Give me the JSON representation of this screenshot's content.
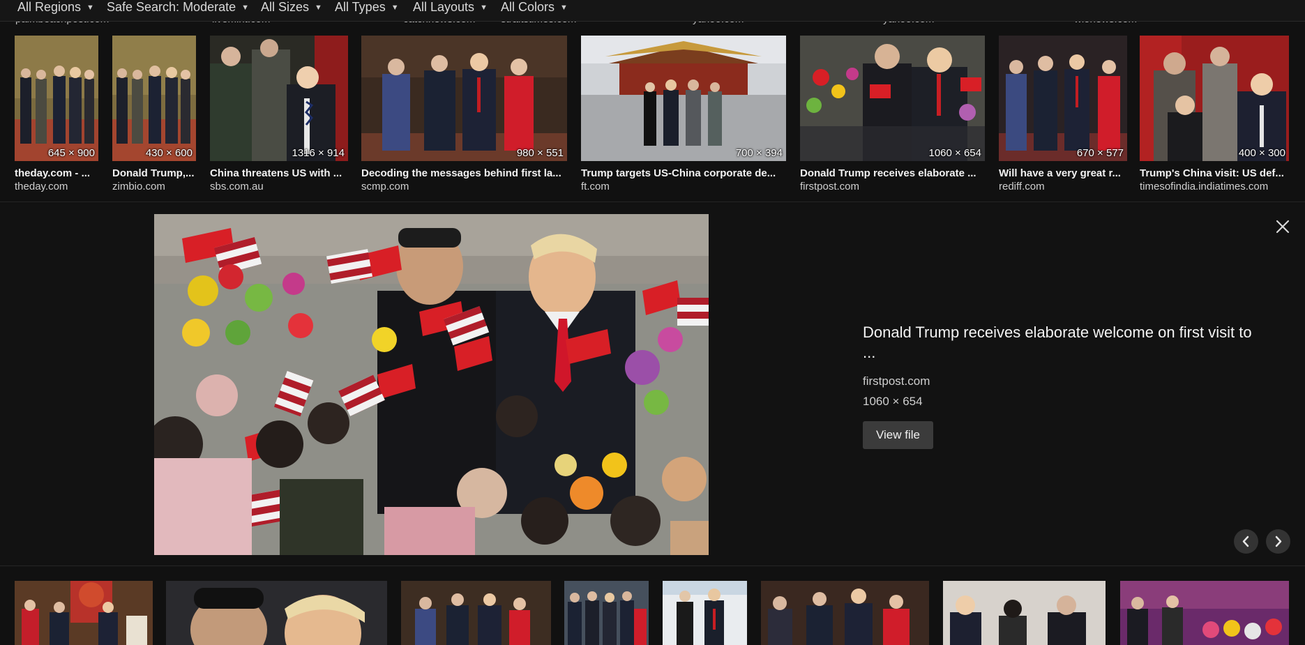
{
  "filters": [
    {
      "label": "All Regions"
    },
    {
      "label": "Safe Search: Moderate"
    },
    {
      "label": "All Sizes"
    },
    {
      "label": "All Types"
    },
    {
      "label": "All Layouts"
    },
    {
      "label": "All Colors"
    }
  ],
  "ghost_sources": [
    "palmbeachpost.com",
    "livemint.com",
    "catchnews.com",
    "straitstimes.com",
    "yahoo.com",
    "yahoo.com",
    "wionews.com"
  ],
  "thumbnails": [
    {
      "dims": "645 × 900",
      "title": "theday.com - ...",
      "source": "theday.com"
    },
    {
      "dims": "430 × 600",
      "title": "Donald Trump,...",
      "source": "zimbio.com"
    },
    {
      "dims": "1316 × 914",
      "title": "China threatens US with ...",
      "source": "sbs.com.au"
    },
    {
      "dims": "980 × 551",
      "title": "Decoding the messages behind first la...",
      "source": "scmp.com"
    },
    {
      "dims": "700 × 394",
      "title": "Trump targets US-China corporate de...",
      "source": "ft.com"
    },
    {
      "dims": "1060 × 654",
      "title": "Donald Trump receives elaborate ...",
      "source": "firstpost.com"
    },
    {
      "dims": "670 × 577",
      "title": "Will have a very great r...",
      "source": "rediff.com"
    },
    {
      "dims": "400 × 300",
      "title": "Trump's China visit: US def...",
      "source": "timesofindia.indiatimes.com"
    }
  ],
  "preview": {
    "title": "Donald Trump receives elaborate welcome on first visit to ...",
    "source": "firstpost.com",
    "dims": "1060 × 654",
    "view_file_label": "View file"
  },
  "icons": {
    "close": "close-icon",
    "prev": "chevron-left-icon",
    "next": "chevron-right-icon",
    "dropdown": "caret-down-icon"
  },
  "colors": {
    "background": "#111111",
    "button": "#3b3b3b",
    "flag_red": "#d81f26"
  }
}
